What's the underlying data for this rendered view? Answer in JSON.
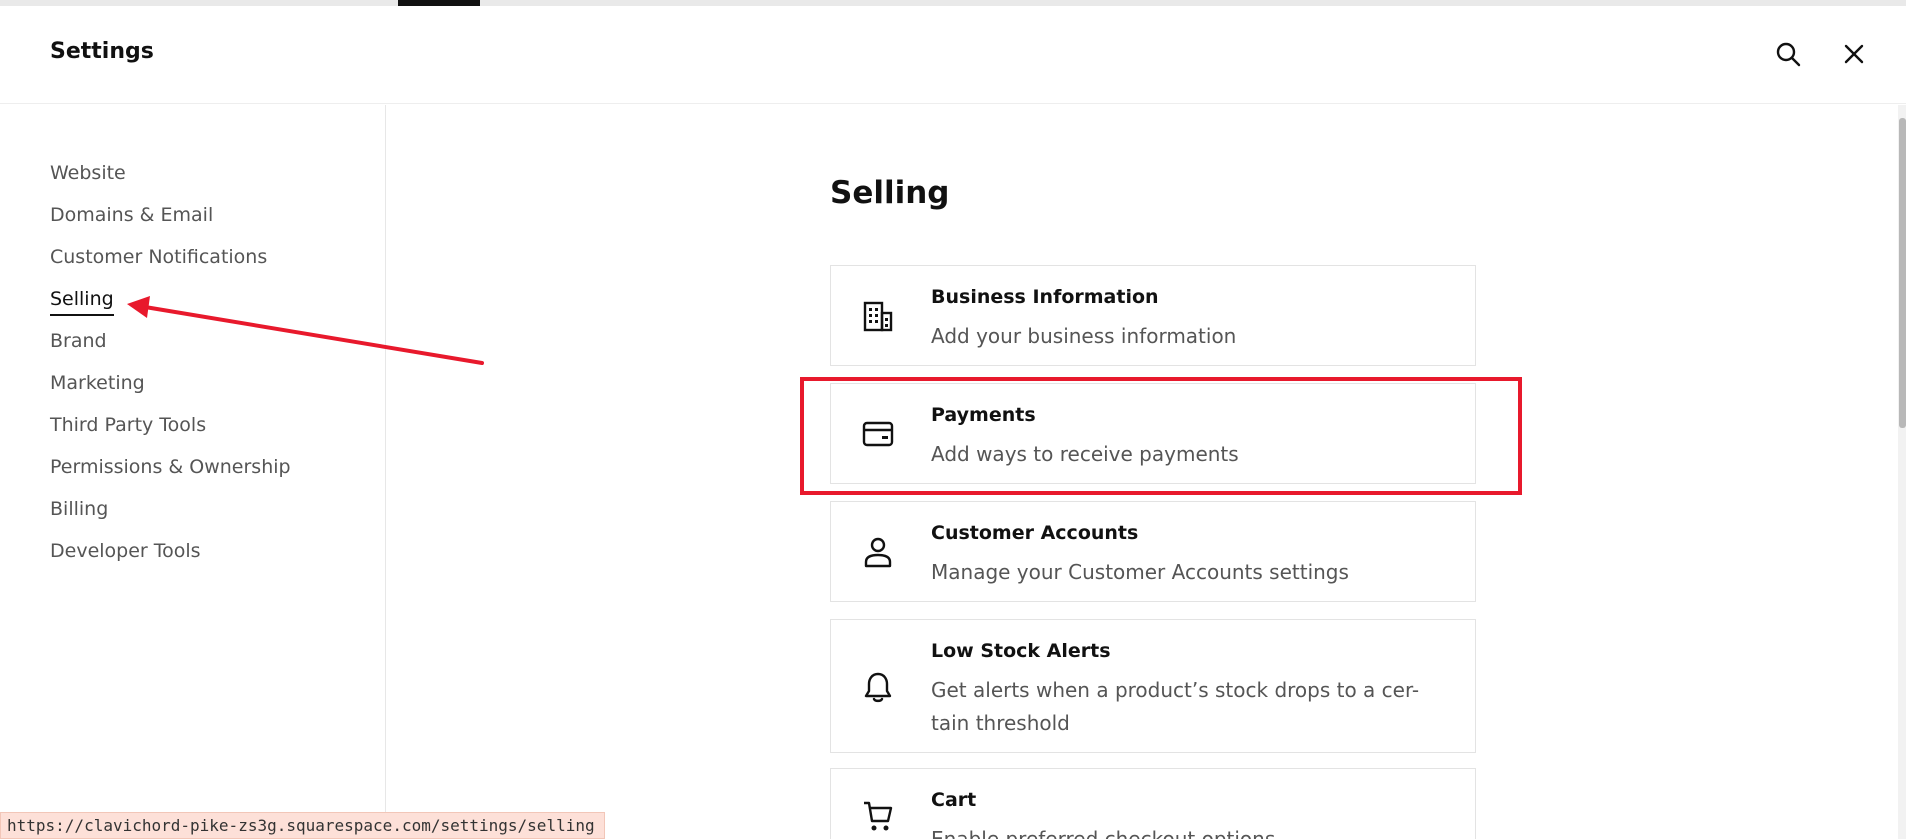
{
  "header": {
    "title": "Settings",
    "search_icon": "search-icon",
    "close_icon": "close-icon"
  },
  "sidebar": {
    "items": [
      {
        "label": "Website",
        "active": false
      },
      {
        "label": "Domains & Email",
        "active": false
      },
      {
        "label": "Customer Notifications",
        "active": false
      },
      {
        "label": "Selling",
        "active": true
      },
      {
        "label": "Brand",
        "active": false
      },
      {
        "label": "Marketing",
        "active": false
      },
      {
        "label": "Third Party Tools",
        "active": false
      },
      {
        "label": "Permissions & Ownership",
        "active": false
      },
      {
        "label": "Billing",
        "active": false
      },
      {
        "label": "Developer Tools",
        "active": false
      }
    ]
  },
  "main": {
    "section_title": "Selling",
    "cards": [
      {
        "icon": "building-icon",
        "title": "Business Information",
        "description": "Add your business information"
      },
      {
        "icon": "credit-card-icon",
        "title": "Payments",
        "description": "Add ways to receive payments"
      },
      {
        "icon": "person-icon",
        "title": "Customer Accounts",
        "description": "Manage your Customer Accounts settings"
      },
      {
        "icon": "bell-icon",
        "title": "Low Stock Alerts",
        "description": "Get alerts when a product’s stock drops to a cer-tain threshold"
      },
      {
        "icon": "cart-icon",
        "title": "Cart",
        "description": "Enable preferred checkout options"
      }
    ]
  },
  "status_bar": {
    "url": "https://clavichord-pike-zs3g.squarespace.com/settings/selling"
  },
  "annotations": {
    "highlight_color": "#e8192c",
    "arrow_color": "#e8192c"
  }
}
